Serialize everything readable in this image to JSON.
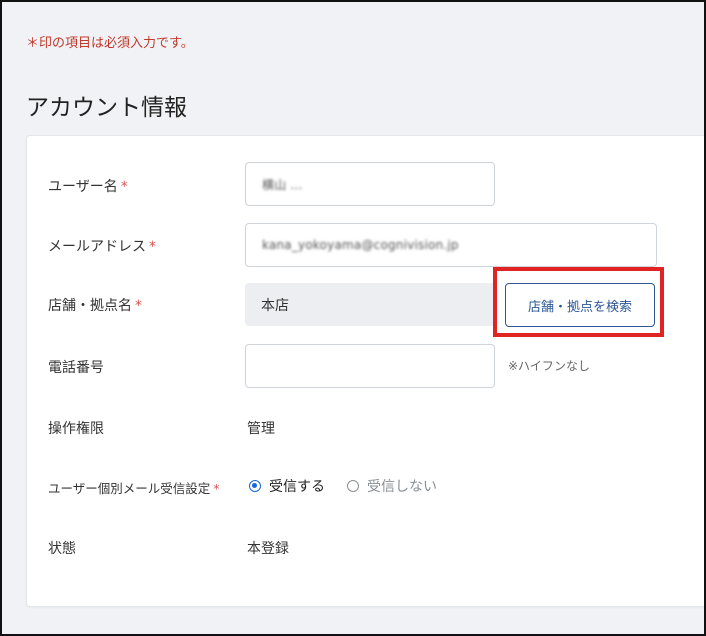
{
  "notice": {
    "required_text": "＊印の項目は必須入力です。"
  },
  "section": {
    "title": "アカウント情報"
  },
  "form": {
    "required_mark": "*",
    "username": {
      "label": "ユーザー名",
      "value": "横山 ..."
    },
    "email": {
      "label": "メールアドレス",
      "value": "kana_yokoyama@cognivision.jp"
    },
    "store": {
      "label": "店舗・拠点名",
      "value": "本店",
      "search_button": "店舗・拠点を検索"
    },
    "phone": {
      "label": "電話番号",
      "value": "",
      "hint": "※ハイフンなし"
    },
    "permission": {
      "label": "操作権限",
      "value": "管理"
    },
    "mail_setting": {
      "label": "ユーザー個別メール受信設定",
      "options": [
        {
          "label": "受信する",
          "checked": true
        },
        {
          "label": "受信しない",
          "checked": false
        }
      ]
    },
    "status": {
      "label": "状態",
      "value": "本登録"
    }
  },
  "colors": {
    "required": "#d9534f",
    "notice": "#c0392b",
    "button_border": "#2b5796",
    "highlight": "#e02424",
    "radio_checked": "#1a66d6",
    "page_bg": "#f0f2f5"
  }
}
